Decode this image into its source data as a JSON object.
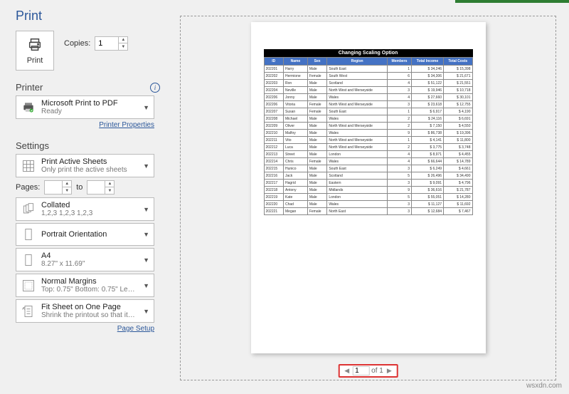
{
  "header": {
    "title": "Print"
  },
  "print_section": {
    "button_label": "Print",
    "copies_label": "Copies:",
    "copies_value": "1"
  },
  "printer": {
    "section_label": "Printer",
    "selected_title": "Microsoft Print to PDF",
    "selected_sub": "Ready",
    "properties_link": "Printer Properties"
  },
  "settings": {
    "section_label": "Settings",
    "print_what": {
      "title": "Print Active Sheets",
      "sub": "Only print the active sheets"
    },
    "pages_label": "Pages:",
    "pages_from": "",
    "pages_to_label": "to",
    "pages_to": "",
    "collate": {
      "title": "Collated",
      "sub": "1,2,3    1,2,3    1,2,3"
    },
    "orientation": {
      "title": "Portrait Orientation",
      "sub": ""
    },
    "paper": {
      "title": "A4",
      "sub": "8.27\" x 11.69\""
    },
    "margins": {
      "title": "Normal Margins",
      "sub": "Top: 0.75\" Bottom: 0.75\" Left:…"
    },
    "scaling": {
      "title": "Fit Sheet on One Page",
      "sub": "Shrink the printout so that it…"
    },
    "page_setup_link": "Page Setup"
  },
  "nav": {
    "current": "1",
    "of_label": "of 1"
  },
  "watermark": "wsxdn.com",
  "doc": {
    "title": "Changing Scaling Option",
    "columns": [
      "ID",
      "Name",
      "Sex",
      "Region",
      "Members",
      "Total Income",
      "Total Costs"
    ]
  },
  "chart_data": {
    "type": "table",
    "title": "Changing Scaling Option",
    "columns": [
      "ID",
      "Name",
      "Sex",
      "Region",
      "Members",
      "Total Income",
      "Total Costs"
    ],
    "rows": [
      [
        "202201",
        "Harry",
        "Male",
        "South East",
        "1",
        "$ 34,246",
        "$ 15,398"
      ],
      [
        "202202",
        "Hermione",
        "Female",
        "South West",
        "6",
        "$ 34,306",
        "$ 21,671"
      ],
      [
        "202203",
        "Ron",
        "Male",
        "Scotland",
        "4",
        "$ 51,122",
        "$ 21,551"
      ],
      [
        "202204",
        "Neville",
        "Male",
        "North West and Merseyside",
        "3",
        "$ 19,946",
        "$ 10,718"
      ],
      [
        "202206",
        "Jonny",
        "Male",
        "Wales",
        "4",
        "$ 27,660",
        "$ 30,101"
      ],
      [
        "202206",
        "Vitoria",
        "Female",
        "North West and Merseyside",
        "3",
        "$ 23,618",
        "$ 12,755"
      ],
      [
        "202207",
        "Susan",
        "Female",
        "South East",
        "1",
        "$ 6,917",
        "$ 4,190"
      ],
      [
        "202208",
        "Michael",
        "Male",
        "Wales",
        "2",
        "$ 24,116",
        "$ 6,691"
      ],
      [
        "202209",
        "Oliver",
        "Male",
        "North West and Merseyside",
        "2",
        "$ 7,150",
        "$ 4,550"
      ],
      [
        "202210",
        "Malfoy",
        "Male",
        "Wales",
        "9",
        "$ 86,738",
        "$ 19,396"
      ],
      [
        "202211",
        "Vito",
        "Male",
        "North West and Merseyside",
        "1",
        "$ 4,141",
        "$ 11,800"
      ],
      [
        "202212",
        "Luca",
        "Male",
        "North West and Merseyside",
        "2",
        "$ 3,775",
        "$ 3,748"
      ],
      [
        "202213",
        "Street",
        "Male",
        "London",
        "4",
        "$ 8,971",
        "$ 4,455"
      ],
      [
        "202214",
        "Chris",
        "Female",
        "Wales",
        "4",
        "$ 66,644",
        "$ 14,789"
      ],
      [
        "202215",
        "Hunico",
        "Male",
        "South East",
        "3",
        "$ 6,249",
        "$ 4,661"
      ],
      [
        "202216",
        "Jack",
        "Male",
        "Scotland",
        "5",
        "$ 26,496",
        "$ 34,490"
      ],
      [
        "202217",
        "Hagrid",
        "Male",
        "Eastern",
        "3",
        "$ 9,091",
        "$ 4,796"
      ],
      [
        "202218",
        "Antony",
        "Male",
        "Midlands",
        "9",
        "$ 36,616",
        "$ 21,787"
      ],
      [
        "202219",
        "Kate",
        "Male",
        "London",
        "5",
        "$ 55,051",
        "$ 14,280"
      ],
      [
        "202220",
        "Chad",
        "Male",
        "Wales",
        "3",
        "$ 11,127",
        "$ 11,692"
      ],
      [
        "202221",
        "Megan",
        "Female",
        "North East",
        "3",
        "$ 12,684",
        "$ 7,467"
      ]
    ]
  }
}
